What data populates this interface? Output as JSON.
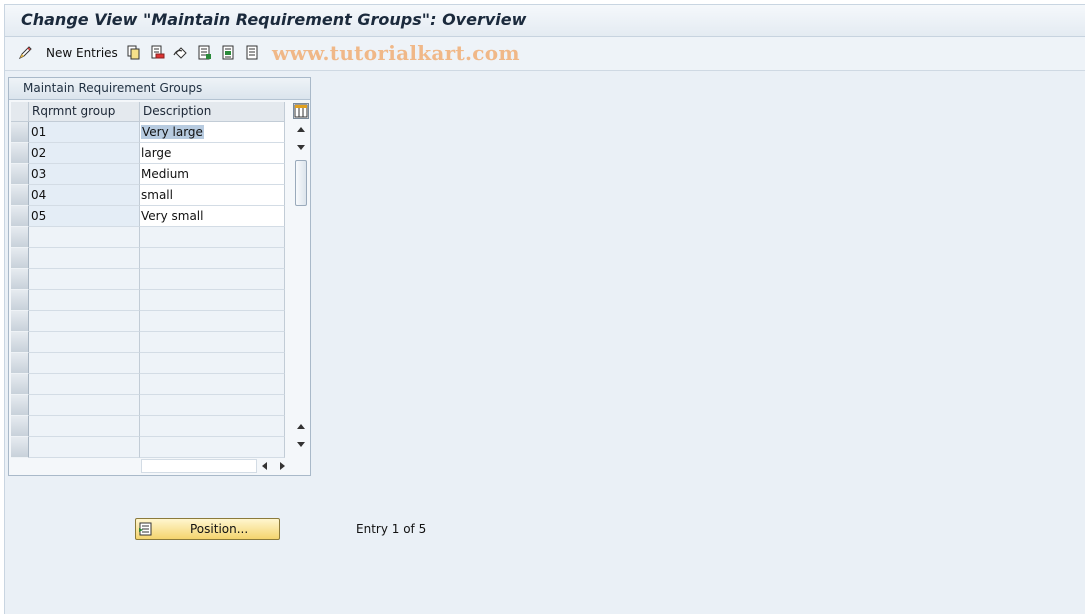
{
  "window": {
    "title": "Change View \"Maintain Requirement Groups\": Overview"
  },
  "toolbar": {
    "new_entries_label": "New Entries",
    "icons": [
      "edit-pencil-icon",
      "copy-icon",
      "delete-icon",
      "undo-icon",
      "select-all-icon",
      "select-block-icon",
      "deselect-all-icon"
    ],
    "watermark": "www.tutorialkart.com"
  },
  "panel": {
    "title": "Maintain Requirement Groups",
    "columns": [
      "Rqrmnt group",
      "Description"
    ],
    "rows": [
      {
        "group": "01",
        "description": "Very large"
      },
      {
        "group": "02",
        "description": "large"
      },
      {
        "group": "03",
        "description": "Medium"
      },
      {
        "group": "04",
        "description": "small"
      },
      {
        "group": "05",
        "description": "Very small"
      }
    ]
  },
  "footer": {
    "position_label": "Position...",
    "entry_info": "Entry 1 of 5"
  },
  "colors": {
    "accent_button": "#f4d46e",
    "background": "#eaf0f6",
    "selection": "#b7cbe0"
  }
}
